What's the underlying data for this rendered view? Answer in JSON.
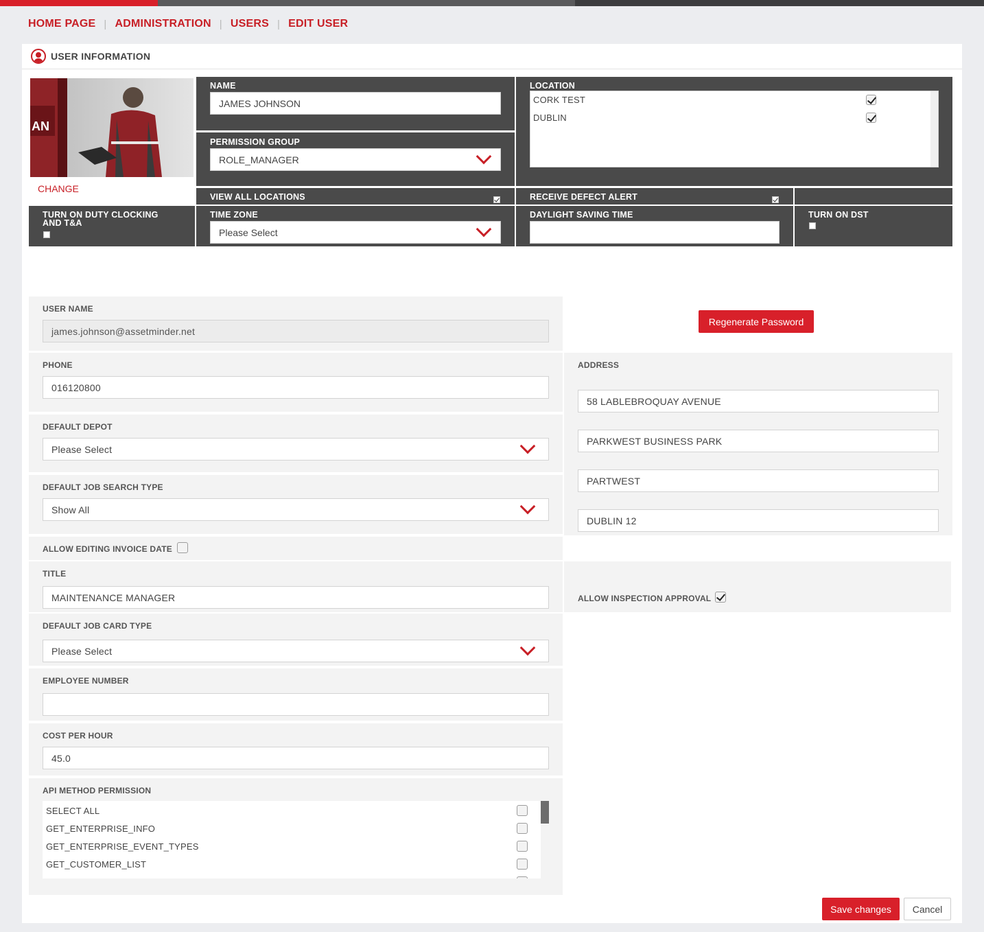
{
  "breadcrumb": [
    "HOME PAGE",
    "ADMINISTRATION",
    "USERS",
    "EDIT USER"
  ],
  "panel_title": "USER INFORMATION",
  "photo": {
    "change_label": "CHANGE",
    "sign_text": "AN"
  },
  "name": {
    "label": "NAME",
    "value": "JAMES JOHNSON"
  },
  "permission_group": {
    "label": "PERMISSION GROUP",
    "value": "ROLE_MANAGER"
  },
  "location": {
    "label": "LOCATION",
    "items": [
      {
        "label": "CORK TEST",
        "checked": true
      },
      {
        "label": "DUBLIN",
        "checked": true
      }
    ]
  },
  "view_all_locations": {
    "label": "VIEW ALL LOCATIONS",
    "checked": true
  },
  "receive_defect_alert": {
    "label": "RECEIVE DEFECT ALERT",
    "checked": true
  },
  "duty_clocking": {
    "label_line1": "TURN ON DUTY CLOCKING",
    "label_line2": "AND T&A",
    "checked": false
  },
  "time_zone": {
    "label": "TIME ZONE",
    "value": "Please Select"
  },
  "daylight_saving": {
    "label": "DAYLIGHT SAVING TIME",
    "value": ""
  },
  "turn_on_dst": {
    "label": "TURN ON DST",
    "checked": false
  },
  "user_name": {
    "label": "USER NAME",
    "value": "james.johnson@assetminder.net"
  },
  "regenerate_label": "Regenerate Password",
  "phone": {
    "label": "PHONE",
    "value": "016120800"
  },
  "address": {
    "label": "ADDRESS",
    "lines": [
      "58 LABLEBROQUAY AVENUE",
      "PARKWEST BUSINESS PARK",
      "PARTWEST",
      "DUBLIN 12"
    ]
  },
  "default_depot": {
    "label": "DEFAULT DEPOT",
    "value": "Please Select"
  },
  "default_job_search_type": {
    "label": "DEFAULT JOB SEARCH TYPE",
    "value": "Show All"
  },
  "allow_editing_invoice_date": {
    "label": "ALLOW EDITING INVOICE DATE",
    "checked": false
  },
  "title": {
    "label": "TITLE",
    "value": "MAINTENANCE MANAGER"
  },
  "allow_inspection_approval": {
    "label": "ALLOW INSPECTION APPROVAL",
    "checked": true
  },
  "default_job_card_type": {
    "label": "DEFAULT JOB CARD TYPE",
    "value": "Please Select"
  },
  "employee_number": {
    "label": "EMPLOYEE NUMBER",
    "value": ""
  },
  "cost_per_hour": {
    "label": "COST PER HOUR",
    "value": "45.0"
  },
  "api_permission": {
    "label": "API METHOD PERMISSION",
    "items": [
      "SELECT ALL",
      "GET_ENTERPRISE_INFO",
      "GET_ENTERPRISE_EVENT_TYPES",
      "GET_CUSTOMER_LIST"
    ]
  },
  "save_label": "Save changes",
  "cancel_label": "Cancel",
  "colors": {
    "accent": "#d8202a",
    "dark_panel": "#4a4a4a",
    "page_bg": "#ecedf0"
  }
}
